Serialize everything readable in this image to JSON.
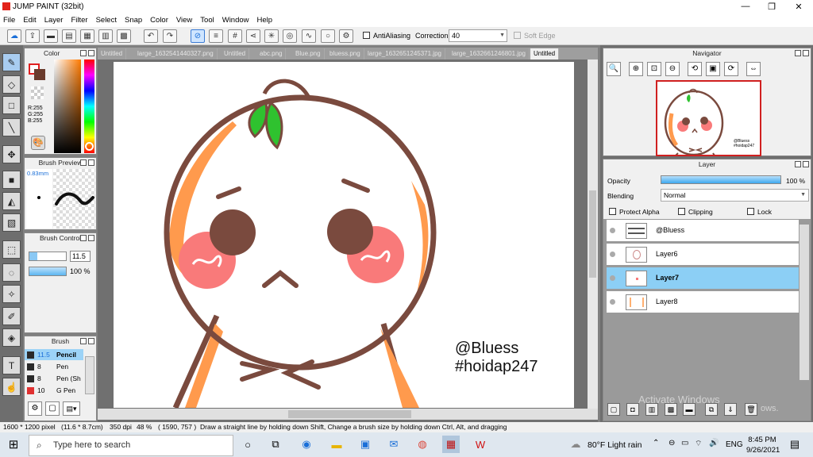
{
  "window": {
    "title": "JUMP PAINT (32bit)",
    "controls": [
      "—",
      "❐",
      "✕"
    ]
  },
  "menu": [
    "File",
    "Edit",
    "Layer",
    "Filter",
    "Select",
    "Snap",
    "Color",
    "View",
    "Tool",
    "Window",
    "Help"
  ],
  "toolbar": {
    "antialiasing_label": "AntiAliasing",
    "correction_label": "Correction",
    "correction_value": "40",
    "softedge_label": "Soft Edge"
  },
  "color_panel": {
    "title": "Color",
    "r": "R:255",
    "g": "G:255",
    "b": "B:255"
  },
  "brush_preview": {
    "title": "Brush Preview",
    "size": "0.83mm"
  },
  "brush_control": {
    "title": "Brush Control",
    "size_value": "11.5",
    "opacity_value": "100 %"
  },
  "brush_panel": {
    "title": "Brush",
    "items": [
      {
        "size": "11.5",
        "name": "Pencil",
        "color": "#2a2a2a"
      },
      {
        "size": "8",
        "name": "Pen",
        "color": "#2a2a2a"
      },
      {
        "size": "8",
        "name": "Pen (Sh",
        "color": "#2a2a2a"
      },
      {
        "size": "10",
        "name": "G Pen",
        "color": "#e03030"
      }
    ]
  },
  "tabs": [
    "Untitled",
    "large_1632541440327.png",
    "Untitled",
    "abc.png",
    "Blue.png",
    "bluess.png",
    "large_1632651245371.jpg",
    "large_1632661246801.jpg",
    "Untitled"
  ],
  "canvas_text": {
    "line1": "@Bluess",
    "line2": "#hoidap247"
  },
  "navigator": {
    "title": "Navigator",
    "thumb_text1": "@Bluess",
    "thumb_text2": "#hoidap247"
  },
  "layer_panel": {
    "title": "Layer",
    "opacity_label": "Opacity",
    "opacity_value": "100 %",
    "opacity_fraction": 1.0,
    "blending_label": "Blending",
    "blending_value": "Normal",
    "protect_alpha": "Protect Alpha",
    "clipping": "Clipping",
    "lock": "Lock",
    "layers": [
      {
        "name": "@Bluess",
        "selected": false
      },
      {
        "name": "Layer6",
        "selected": false
      },
      {
        "name": "Layer7",
        "selected": true
      },
      {
        "name": "Layer8",
        "selected": false
      }
    ]
  },
  "watermark": {
    "line1": "Activate Windows",
    "line2": "ows."
  },
  "status": {
    "size": "1600 * 1200 pixel",
    "cm": "(11.6 * 8.7cm)",
    "dpi": "350 dpi",
    "zoom": "48 %",
    "coords": "( 1590, 757 )",
    "hint": "Draw a straight line by holding down Shift, Change a brush size by holding down Ctrl, Alt, and dragging"
  },
  "taskbar": {
    "search_placeholder": "Type here to search",
    "weather": "80°F  Light rain",
    "lang": "ENG",
    "time": "8:45 PM",
    "date": "9/26/2021"
  },
  "colors": {
    "accent": "#1e90ff",
    "selected_layer": "#8ccff5",
    "character_outline": "#7a4a3e",
    "orange": "#ff9a4d",
    "cheek": "#f97a7a",
    "leaf": "#2fc22f"
  }
}
